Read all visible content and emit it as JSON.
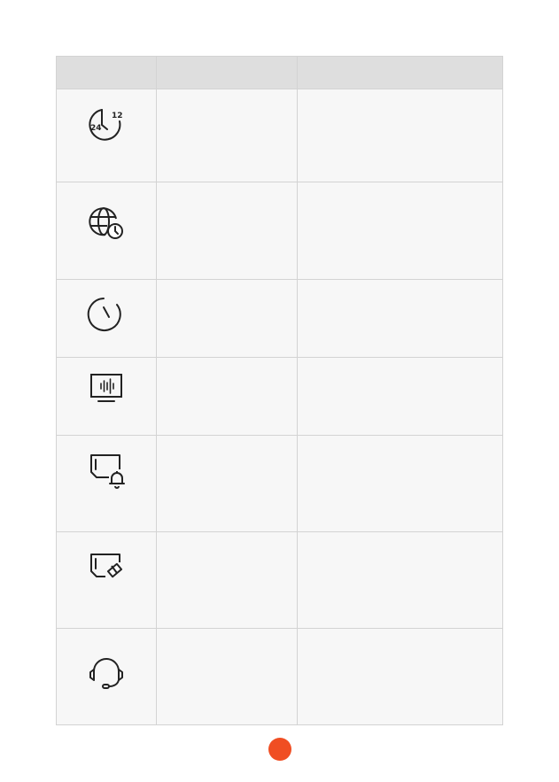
{
  "table": {
    "headers": [
      "",
      "",
      ""
    ],
    "rows": [
      {
        "icon": "clock-24-12-icon",
        "name": "",
        "description": ""
      },
      {
        "icon": "globe-clock-icon",
        "name": "",
        "description": ""
      },
      {
        "icon": "timer-icon",
        "name": "",
        "description": ""
      },
      {
        "icon": "monitor-audio-icon",
        "name": "",
        "description": ""
      },
      {
        "icon": "screen-bell-icon",
        "name": "",
        "description": ""
      },
      {
        "icon": "screen-eraser-icon",
        "name": "",
        "description": ""
      },
      {
        "icon": "headset-icon",
        "name": "",
        "description": ""
      }
    ]
  },
  "colors": {
    "header_bg": "#dedede",
    "row_bg": "#f7f7f7",
    "border": "#d3d3d3",
    "icon_stroke": "#222222",
    "page_dot": "#f04e23"
  }
}
